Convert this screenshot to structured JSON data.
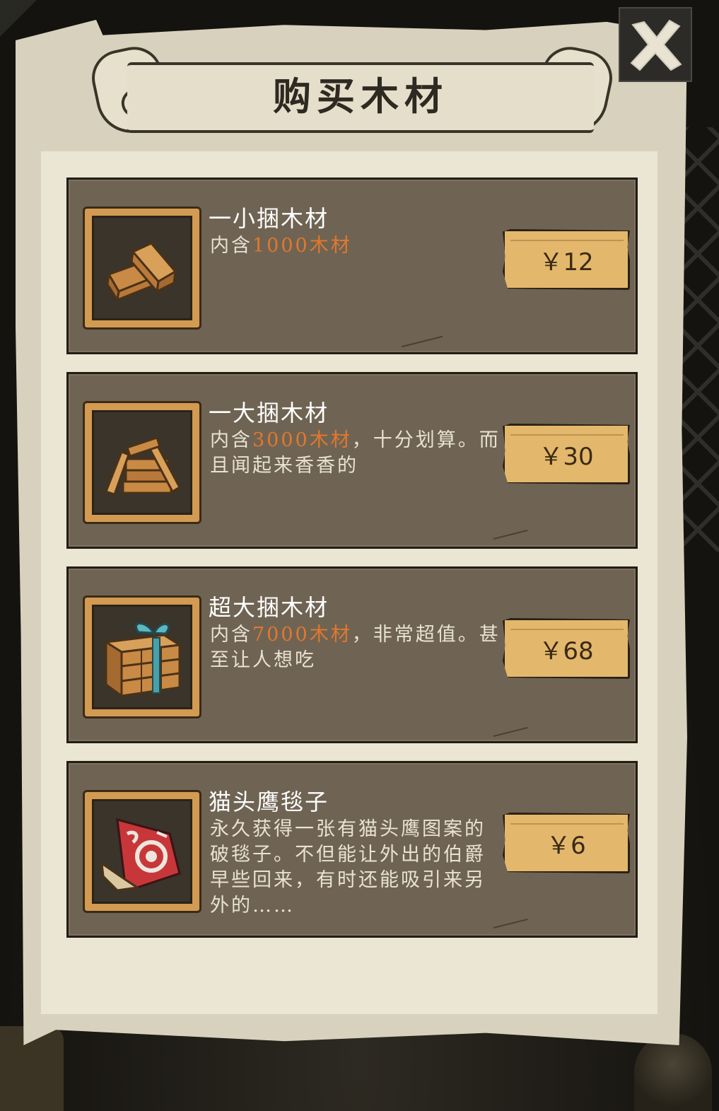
{
  "title": "购买木材",
  "close_icon": "close-x-icon",
  "items": [
    {
      "name": "一小捆木材",
      "desc_prefix": "内含",
      "desc_highlight": "1000木材",
      "desc_suffix": "",
      "price": "￥12",
      "icon": "small-wood-bundle-icon"
    },
    {
      "name": "一大捆木材",
      "desc_prefix": "内含",
      "desc_highlight": "3000木材",
      "desc_suffix": "，十分划算。而且闻起来香香的",
      "price": "￥30",
      "icon": "large-wood-bundle-icon"
    },
    {
      "name": "超大捆木材",
      "desc_prefix": "内含",
      "desc_highlight": "7000木材",
      "desc_suffix": "，非常超值。甚至让人想吃",
      "price": "￥68",
      "icon": "wood-crate-gift-icon"
    },
    {
      "name": "猫头鹰毯子",
      "desc_prefix": "永久获得一张有猫头鹰图案的破毯子。不但能让外出的伯爵早些回来，有时还能吸引来另外的……",
      "desc_highlight": "",
      "desc_suffix": "",
      "price": "￥6",
      "icon": "owl-blanket-icon"
    }
  ],
  "colors": {
    "parchment": "#d8d1bd",
    "panel": "#6f6453",
    "price_button": "#e3b86c",
    "highlight": "#e2772e"
  }
}
